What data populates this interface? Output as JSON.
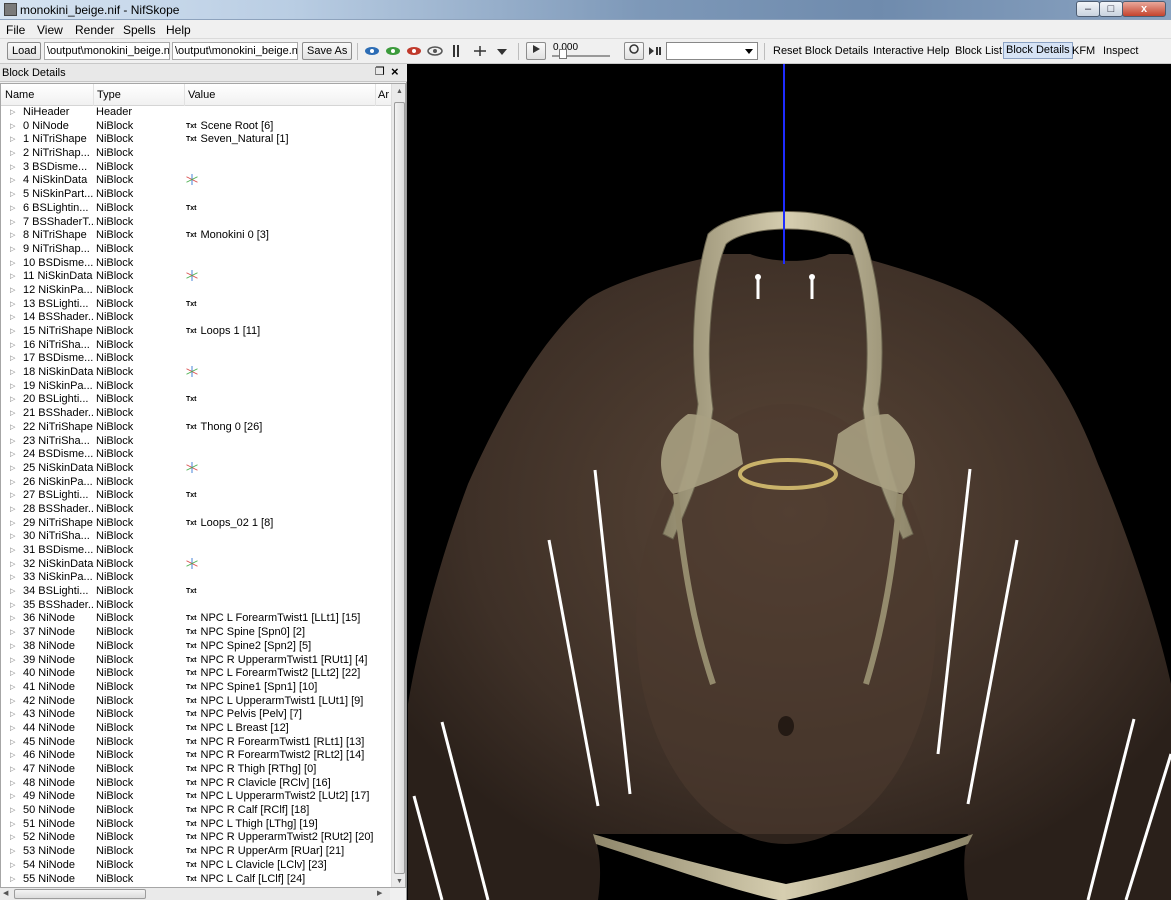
{
  "window": {
    "title": "monokini_beige.nif - NifSkope"
  },
  "menu": [
    "File",
    "View",
    "Render",
    "Spells",
    "Help"
  ],
  "toolbar": {
    "load_label": "Load",
    "load_path": "\\output\\monokini_beige.nif",
    "save_path": "\\output\\monokini_beige.nif",
    "save_as_label": "Save As",
    "time_value": "0.000",
    "reset_block_details": "Reset Block Details",
    "interactive_help": "Interactive Help",
    "block_list": "Block List",
    "block_details": "Block Details",
    "kfm": "KFM",
    "inspect": "Inspect"
  },
  "dock": {
    "title": "Block Details"
  },
  "tree": {
    "columns": [
      "Name",
      "Type",
      "Value",
      "Ar"
    ],
    "rows": [
      {
        "name": "NiHeader",
        "type": "Header",
        "value": "",
        "icon": ""
      },
      {
        "name": "0 NiNode",
        "type": "NiBlock",
        "value": "Scene Root [6]",
        "icon": "txt"
      },
      {
        "name": "1 NiTriShape",
        "type": "NiBlock",
        "value": "Seven_Natural [1]",
        "icon": "txt"
      },
      {
        "name": "2 NiTriShap...",
        "type": "NiBlock",
        "value": "",
        "icon": ""
      },
      {
        "name": "3 BSDisme...",
        "type": "NiBlock",
        "value": "",
        "icon": ""
      },
      {
        "name": "4 NiSkinData",
        "type": "NiBlock",
        "value": "",
        "icon": "axes"
      },
      {
        "name": "5 NiSkinPart...",
        "type": "NiBlock",
        "value": "",
        "icon": ""
      },
      {
        "name": "6 BSLightin...",
        "type": "NiBlock",
        "value": "",
        "icon": "txt"
      },
      {
        "name": "7 BSShaderT...",
        "type": "NiBlock",
        "value": "",
        "icon": ""
      },
      {
        "name": "8 NiTriShape",
        "type": "NiBlock",
        "value": "Monokini 0 [3]",
        "icon": "txt"
      },
      {
        "name": "9 NiTriShap...",
        "type": "NiBlock",
        "value": "",
        "icon": ""
      },
      {
        "name": "10 BSDisme...",
        "type": "NiBlock",
        "value": "",
        "icon": ""
      },
      {
        "name": "11 NiSkinData",
        "type": "NiBlock",
        "value": "",
        "icon": "axes"
      },
      {
        "name": "12 NiSkinPa...",
        "type": "NiBlock",
        "value": "",
        "icon": ""
      },
      {
        "name": "13 BSLighti...",
        "type": "NiBlock",
        "value": "",
        "icon": "txt"
      },
      {
        "name": "14 BSShader...",
        "type": "NiBlock",
        "value": "",
        "icon": ""
      },
      {
        "name": "15 NiTriShape",
        "type": "NiBlock",
        "value": "Loops 1 [11]",
        "icon": "txt"
      },
      {
        "name": "16 NiTriSha...",
        "type": "NiBlock",
        "value": "",
        "icon": ""
      },
      {
        "name": "17 BSDisme...",
        "type": "NiBlock",
        "value": "",
        "icon": ""
      },
      {
        "name": "18 NiSkinData",
        "type": "NiBlock",
        "value": "",
        "icon": "axes"
      },
      {
        "name": "19 NiSkinPa...",
        "type": "NiBlock",
        "value": "",
        "icon": ""
      },
      {
        "name": "20 BSLighti...",
        "type": "NiBlock",
        "value": "",
        "icon": "txt"
      },
      {
        "name": "21 BSShader...",
        "type": "NiBlock",
        "value": "",
        "icon": ""
      },
      {
        "name": "22 NiTriShape",
        "type": "NiBlock",
        "value": "Thong 0 [26]",
        "icon": "txt"
      },
      {
        "name": "23 NiTriSha...",
        "type": "NiBlock",
        "value": "",
        "icon": ""
      },
      {
        "name": "24 BSDisme...",
        "type": "NiBlock",
        "value": "",
        "icon": ""
      },
      {
        "name": "25 NiSkinData",
        "type": "NiBlock",
        "value": "",
        "icon": "axes"
      },
      {
        "name": "26 NiSkinPa...",
        "type": "NiBlock",
        "value": "",
        "icon": ""
      },
      {
        "name": "27 BSLighti...",
        "type": "NiBlock",
        "value": "",
        "icon": "txt"
      },
      {
        "name": "28 BSShader...",
        "type": "NiBlock",
        "value": "",
        "icon": ""
      },
      {
        "name": "29 NiTriShape",
        "type": "NiBlock",
        "value": "Loops_02 1 [8]",
        "icon": "txt"
      },
      {
        "name": "30 NiTriSha...",
        "type": "NiBlock",
        "value": "",
        "icon": ""
      },
      {
        "name": "31 BSDisme...",
        "type": "NiBlock",
        "value": "",
        "icon": ""
      },
      {
        "name": "32 NiSkinData",
        "type": "NiBlock",
        "value": "",
        "icon": "axes"
      },
      {
        "name": "33 NiSkinPa...",
        "type": "NiBlock",
        "value": "",
        "icon": ""
      },
      {
        "name": "34 BSLighti...",
        "type": "NiBlock",
        "value": "",
        "icon": "txt"
      },
      {
        "name": "35 BSShader...",
        "type": "NiBlock",
        "value": "",
        "icon": ""
      },
      {
        "name": "36 NiNode",
        "type": "NiBlock",
        "value": "NPC L ForearmTwist1 [LLt1] [15]",
        "icon": "txt"
      },
      {
        "name": "37 NiNode",
        "type": "NiBlock",
        "value": "NPC Spine [Spn0] [2]",
        "icon": "txt"
      },
      {
        "name": "38 NiNode",
        "type": "NiBlock",
        "value": "NPC Spine2 [Spn2] [5]",
        "icon": "txt"
      },
      {
        "name": "39 NiNode",
        "type": "NiBlock",
        "value": "NPC R UpperarmTwist1 [RUt1] [4]",
        "icon": "txt"
      },
      {
        "name": "40 NiNode",
        "type": "NiBlock",
        "value": "NPC L ForearmTwist2 [LLt2] [22]",
        "icon": "txt"
      },
      {
        "name": "41 NiNode",
        "type": "NiBlock",
        "value": "NPC Spine1 [Spn1] [10]",
        "icon": "txt"
      },
      {
        "name": "42 NiNode",
        "type": "NiBlock",
        "value": "NPC L UpperarmTwist1 [LUt1] [9]",
        "icon": "txt"
      },
      {
        "name": "43 NiNode",
        "type": "NiBlock",
        "value": "NPC Pelvis [Pelv] [7]",
        "icon": "txt"
      },
      {
        "name": "44 NiNode",
        "type": "NiBlock",
        "value": "NPC L Breast [12]",
        "icon": "txt"
      },
      {
        "name": "45 NiNode",
        "type": "NiBlock",
        "value": "NPC R ForearmTwist1 [RLt1] [13]",
        "icon": "txt"
      },
      {
        "name": "46 NiNode",
        "type": "NiBlock",
        "value": "NPC R ForearmTwist2 [RLt2] [14]",
        "icon": "txt"
      },
      {
        "name": "47 NiNode",
        "type": "NiBlock",
        "value": "NPC R Thigh [RThg] [0]",
        "icon": "txt"
      },
      {
        "name": "48 NiNode",
        "type": "NiBlock",
        "value": "NPC R Clavicle [RClv] [16]",
        "icon": "txt"
      },
      {
        "name": "49 NiNode",
        "type": "NiBlock",
        "value": "NPC L UpperarmTwist2 [LUt2] [17]",
        "icon": "txt"
      },
      {
        "name": "50 NiNode",
        "type": "NiBlock",
        "value": "NPC R Calf [RClf] [18]",
        "icon": "txt"
      },
      {
        "name": "51 NiNode",
        "type": "NiBlock",
        "value": "NPC L Thigh [LThg] [19]",
        "icon": "txt"
      },
      {
        "name": "52 NiNode",
        "type": "NiBlock",
        "value": "NPC R UpperarmTwist2 [RUt2] [20]",
        "icon": "txt"
      },
      {
        "name": "53 NiNode",
        "type": "NiBlock",
        "value": "NPC R UpperArm [RUar] [21]",
        "icon": "txt"
      },
      {
        "name": "54 NiNode",
        "type": "NiBlock",
        "value": "NPC L Clavicle [LClv] [23]",
        "icon": "txt"
      },
      {
        "name": "55 NiNode",
        "type": "NiBlock",
        "value": "NPC L Calf [LClf] [24]",
        "icon": "txt"
      }
    ],
    "txt_label": "Txt"
  },
  "colors": {
    "axis_blue": "#1e2cff",
    "skin": "#4a3a2e",
    "strap": "#b8ad8c",
    "bone_line": "#ffffff"
  }
}
